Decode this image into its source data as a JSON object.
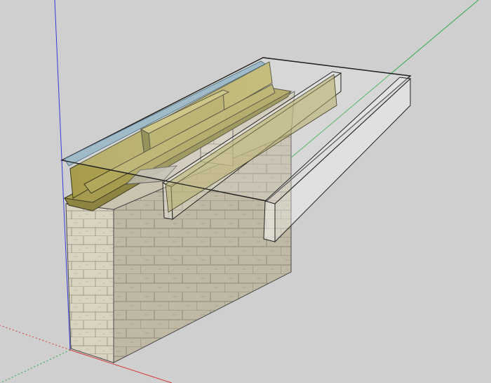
{
  "app": "SketchUp",
  "viewport": {
    "background_color": "#d0d0d0",
    "axes": {
      "red": "#d23a3a",
      "green": "#2fa84a",
      "blue": "#3a3ad6"
    },
    "model": {
      "type": "wall-and-roof-assembly",
      "materials": {
        "block_light": "#d7d2bf",
        "block_dark": "#bdb6a2",
        "timber": "#a49b4b",
        "timber_light": "#bdb56a",
        "timber_dark": "#7f7a35",
        "glass_edge": "#222222",
        "glass_fill": "#ffffff",
        "glass_blue": "#8fb0c2"
      }
    }
  }
}
